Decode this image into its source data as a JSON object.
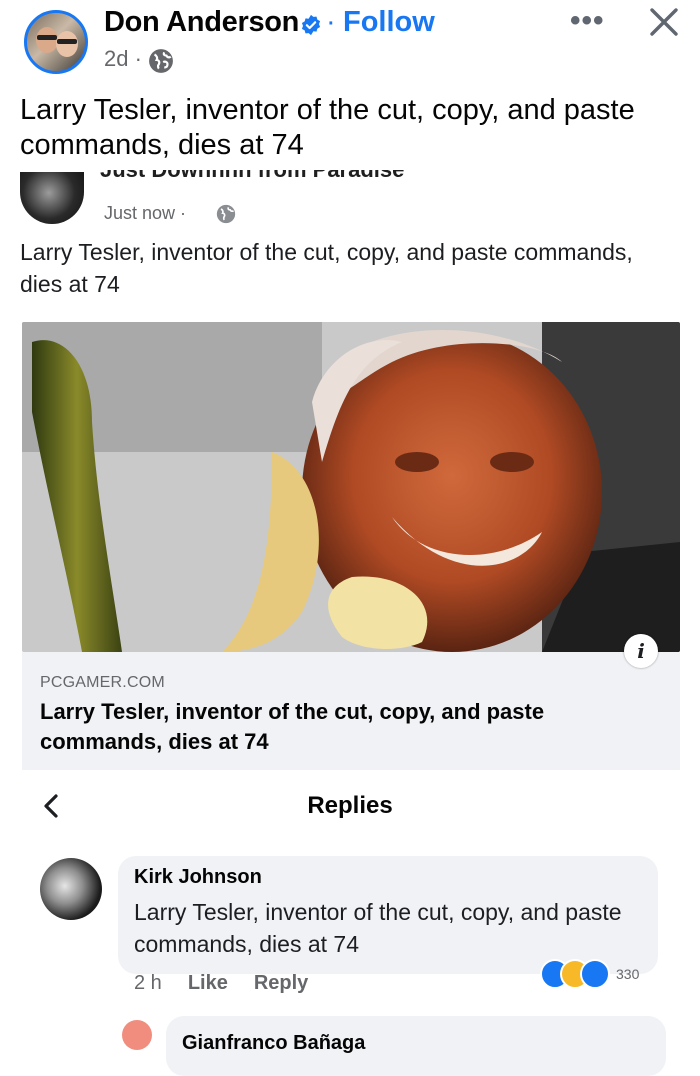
{
  "post": {
    "author": "Don Anderson",
    "follow_label": "Follow",
    "separator": "·",
    "time": "2d ·",
    "more_label": "•••",
    "caption": "Larry Tesler, inventor of the cut, copy, and paste commands, dies at 74"
  },
  "embedded": {
    "author_partial": "Just Downnnn from Paradise",
    "time": "Just now ·",
    "caption": "Larry Tesler, inventor of the cut, copy, and paste commands, dies at 74",
    "link": {
      "domain": "PCGAMER.COM",
      "title": "Larry Tesler, inventor of the cut, copy, and paste commands, dies at 74",
      "info_label": "i"
    }
  },
  "replies": {
    "title": "Replies",
    "comments": [
      {
        "name": "Kirk Johnson",
        "text": "Larry Tesler, inventor of the cut, copy, and paste commands, dies at 74",
        "time": "2 h",
        "like_label": "Like",
        "reply_label": "Reply",
        "reaction_count": "330"
      },
      {
        "name": "Gianfranco Bañaga"
      }
    ]
  },
  "colors": {
    "accent": "#1877f2",
    "secondary_text": "#65676b",
    "card_bg": "#f0f2f5"
  },
  "icons": [
    "verified-badge-icon",
    "more-icon",
    "close-icon",
    "globe-icon",
    "info-icon",
    "back-chevron-icon",
    "like-reaction-icon",
    "haha-reaction-icon",
    "wow-reaction-icon"
  ]
}
